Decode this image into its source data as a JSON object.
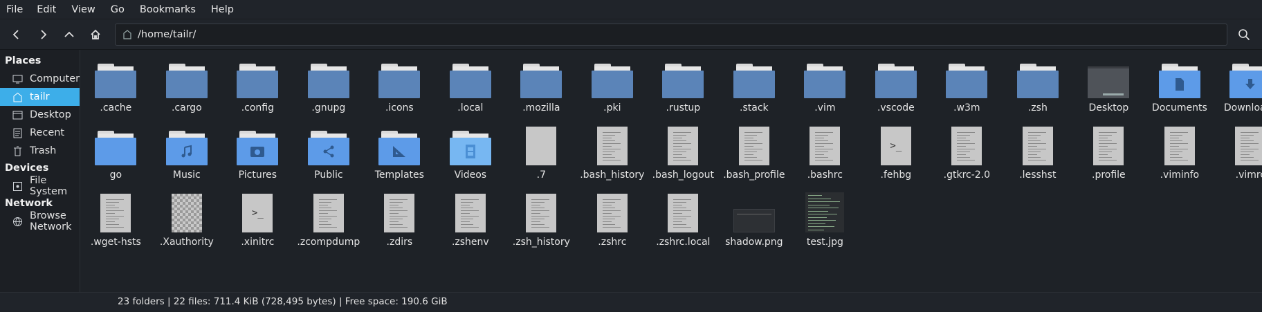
{
  "menu": [
    "File",
    "Edit",
    "View",
    "Go",
    "Bookmarks",
    "Help"
  ],
  "location": {
    "path": "/home/tailr/"
  },
  "sidebar": {
    "places_title": "Places",
    "places": [
      {
        "label": "Computer",
        "icon": "computer-icon"
      },
      {
        "label": "tailr",
        "icon": "home-icon",
        "active": true
      },
      {
        "label": "Desktop",
        "icon": "desktop-icon"
      },
      {
        "label": "Recent",
        "icon": "recent-icon"
      },
      {
        "label": "Trash",
        "icon": "trash-icon"
      }
    ],
    "devices_title": "Devices",
    "devices": [
      {
        "label": "File System",
        "icon": "drive-icon"
      }
    ],
    "network_title": "Network",
    "network": [
      {
        "label": "Browse Network",
        "icon": "network-icon"
      }
    ]
  },
  "files": [
    {
      "name": ".cache",
      "kind": "folder"
    },
    {
      "name": ".cargo",
      "kind": "folder"
    },
    {
      "name": ".config",
      "kind": "folder"
    },
    {
      "name": ".gnupg",
      "kind": "folder"
    },
    {
      "name": ".icons",
      "kind": "folder"
    },
    {
      "name": ".local",
      "kind": "folder"
    },
    {
      "name": ".mozilla",
      "kind": "folder"
    },
    {
      "name": ".pki",
      "kind": "folder"
    },
    {
      "name": ".rustup",
      "kind": "folder"
    },
    {
      "name": ".stack",
      "kind": "folder"
    },
    {
      "name": ".vim",
      "kind": "folder"
    },
    {
      "name": ".vscode",
      "kind": "folder"
    },
    {
      "name": ".w3m",
      "kind": "folder"
    },
    {
      "name": ".zsh",
      "kind": "folder"
    },
    {
      "name": "Desktop",
      "kind": "desktop"
    },
    {
      "name": "Documents",
      "kind": "folder-documents"
    },
    {
      "name": "Downloads",
      "kind": "folder-downloads"
    },
    {
      "name": "go",
      "kind": "folder-light"
    },
    {
      "name": "Music",
      "kind": "folder-music"
    },
    {
      "name": "Pictures",
      "kind": "folder-pictures"
    },
    {
      "name": "Public",
      "kind": "folder-public"
    },
    {
      "name": "Templates",
      "kind": "folder-templates"
    },
    {
      "name": "Videos",
      "kind": "folder-videos"
    },
    {
      "name": ".7",
      "kind": "blank"
    },
    {
      "name": ".bash_history",
      "kind": "text"
    },
    {
      "name": ".bash_logout",
      "kind": "text"
    },
    {
      "name": ".bash_profile",
      "kind": "text"
    },
    {
      "name": ".bashrc",
      "kind": "text"
    },
    {
      "name": ".fehbg",
      "kind": "script"
    },
    {
      "name": ".gtkrc-2.0",
      "kind": "text"
    },
    {
      "name": ".lesshst",
      "kind": "text"
    },
    {
      "name": ".profile",
      "kind": "text"
    },
    {
      "name": ".viminfo",
      "kind": "text"
    },
    {
      "name": ".vimrc",
      "kind": "text"
    },
    {
      "name": ".wget-hsts",
      "kind": "text"
    },
    {
      "name": ".Xauthority",
      "kind": "checker"
    },
    {
      "name": ".xinitrc",
      "kind": "script"
    },
    {
      "name": ".zcompdump",
      "kind": "text"
    },
    {
      "name": ".zdirs",
      "kind": "text"
    },
    {
      "name": ".zshenv",
      "kind": "text"
    },
    {
      "name": ".zsh_history",
      "kind": "text"
    },
    {
      "name": ".zshrc",
      "kind": "text"
    },
    {
      "name": ".zshrc.local",
      "kind": "text"
    },
    {
      "name": "shadow.png",
      "kind": "image-shadow"
    },
    {
      "name": "test.jpg",
      "kind": "image-test"
    }
  ],
  "status": "23 folders  |  22 files: 711.4 KiB (728,495 bytes)  |  Free space: 190.6 GiB",
  "colors": {
    "accent": "#3daee9",
    "folder": "#5b84b8",
    "folder_light": "#5d9be8"
  }
}
